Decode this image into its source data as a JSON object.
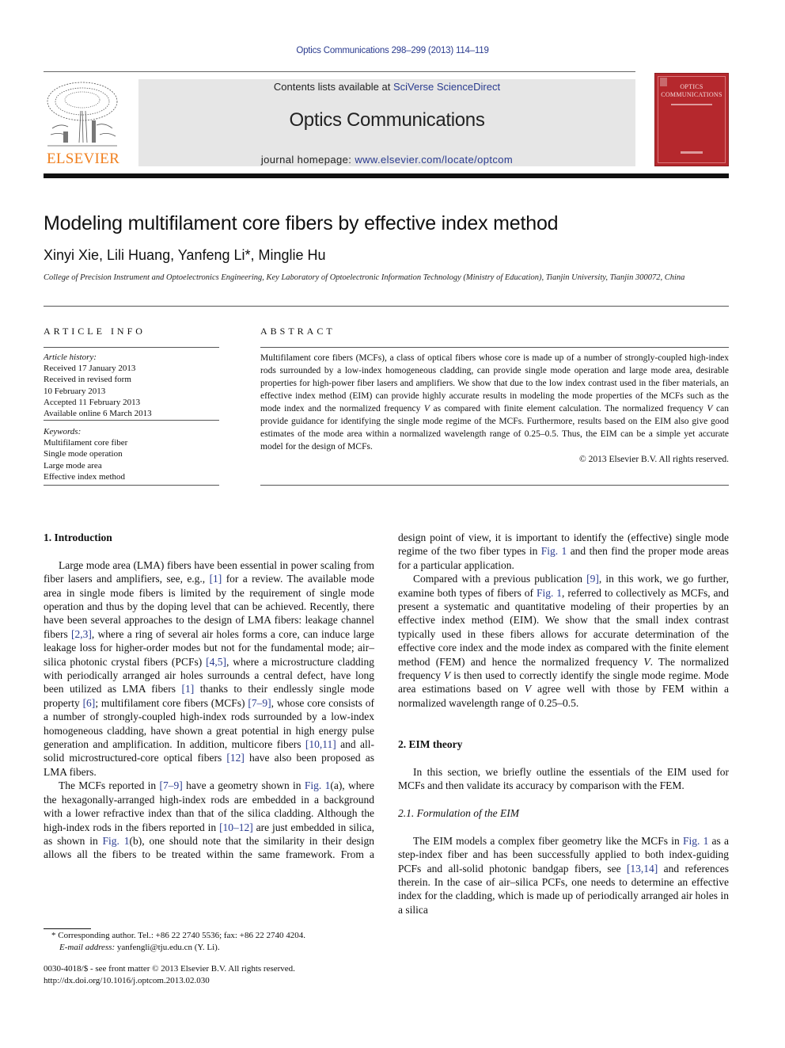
{
  "header": {
    "citation": "Optics Communications 298–299 (2013) 114–119",
    "contents_prefix": "Contents lists available at ",
    "contents_link": "SciVerse ScienceDirect",
    "journal_title": "Optics Communications",
    "homepage_prefix": "journal homepage: ",
    "homepage_link": "www.elsevier.com/locate/optcom",
    "publisher_logo_text": "ELSEVIER",
    "cover_title_line1": "OPTICS",
    "cover_title_line2": "COMMUNICATIONS",
    "colors": {
      "link": "#2a3b8f",
      "publisher_orange": "#f07f1e",
      "cover_red": "#b5282d",
      "banner_gray": "#e6e6e6"
    }
  },
  "article": {
    "title": "Modeling multifilament core fibers by effective index method",
    "authors": "Xinyi Xie, Lili Huang, Yanfeng Li*, Minglie Hu",
    "affiliation": "College of Precision Instrument and Optoelectronics Engineering, Key Laboratory of Optoelectronic Information Technology (Ministry of Education), Tianjin University, Tianjin 300072, China"
  },
  "article_info": {
    "heading": "ARTICLE INFO",
    "history_label": "Article history:",
    "history": [
      "Received 17 January 2013",
      "Received in revised form",
      "10 February 2013",
      "Accepted 11 February 2013",
      "Available online 6 March 2013"
    ],
    "keywords_label": "Keywords:",
    "keywords": [
      "Multifilament core fiber",
      "Single mode operation",
      "Large mode area",
      "Effective index method"
    ]
  },
  "abstract": {
    "heading": "ABSTRACT",
    "text": "Multifilament core fibers (MCFs), a class of optical fibers whose core is made up of a number of strongly-coupled high-index rods surrounded by a low-index homogeneous cladding, can provide single mode operation and large mode area, desirable properties for high-power fiber lasers and amplifiers. We show that due to the low index contrast used in the fiber materials, an effective index method (EIM) can provide highly accurate results in modeling the mode properties of the MCFs such as the mode index and the normalized frequency V as compared with finite element calculation. The normalized frequency V can provide guidance for identifying the single mode regime of the MCFs. Furthermore, results based on the EIM also give good estimates of the mode area within a normalized wavelength range of 0.25–0.5. Thus, the EIM can be a simple yet accurate model for the design of MCFs.",
    "copyright": "© 2013 Elsevier B.V. All rights reserved."
  },
  "body": {
    "sec1_heading": "1.  Introduction",
    "sec1_p1": [
      {
        "t": "Large mode area (LMA) fibers have been essential in power scaling from fiber lasers and amplifiers, see, e.g., "
      },
      {
        "t": "[1]",
        "link": true
      },
      {
        "t": " for a review. The available mode area in single mode fibers is limited by the requirement of single mode operation and thus by the doping level that can be achieved. Recently, there have been several approaches to the design of LMA fibers: leakage channel fibers "
      },
      {
        "t": "[2,3]",
        "link": true
      },
      {
        "t": ", where a ring of several air holes forms a core, can induce large leakage loss for higher-order modes but not for the fundamental mode; air–silica photonic crystal fibers (PCFs) "
      },
      {
        "t": "[4,5]",
        "link": true
      },
      {
        "t": ", where a microstructure cladding with periodically arranged air holes surrounds a central defect, have long been utilized as LMA fibers "
      },
      {
        "t": "[1]",
        "link": true
      },
      {
        "t": " thanks to their endlessly single mode property "
      },
      {
        "t": "[6]",
        "link": true
      },
      {
        "t": "; multifilament core fibers (MCFs) "
      },
      {
        "t": "[7–9]",
        "link": true
      },
      {
        "t": ", whose core consists of a number of strongly-coupled high-index rods surrounded by a low-index homogeneous cladding, have shown a great potential in high energy pulse generation and amplification. In addition, multicore fibers "
      },
      {
        "t": "[10,11]",
        "link": true
      },
      {
        "t": " and all-solid microstructured-core optical fibers "
      },
      {
        "t": "[12]",
        "link": true
      },
      {
        "t": " have also been proposed as LMA fibers."
      }
    ],
    "sec1_p2": [
      {
        "t": "The MCFs reported in "
      },
      {
        "t": "[7–9]",
        "link": true
      },
      {
        "t": " have a geometry shown in "
      },
      {
        "t": "Fig. 1",
        "link": true
      },
      {
        "t": "(a), where the hexagonally-arranged high-index rods are embedded in a background with a lower refractive index than that of the silica cladding. Although the high-index rods in the fibers reported in "
      },
      {
        "t": "[10–12]",
        "link": true
      },
      {
        "t": " are just embedded in silica, as shown in "
      },
      {
        "t": "Fig. 1",
        "link": true
      },
      {
        "t": "(b), one should note that the similarity in their design allows all the fibers to be treated within the same framework. From a design point of view, it is important to identify the (effective) single mode regime of the two fiber types in "
      },
      {
        "t": "Fig. 1",
        "link": true
      },
      {
        "t": " and then find the proper mode areas for a particular application."
      }
    ],
    "sec1_p3": [
      {
        "t": "Compared with a previous publication "
      },
      {
        "t": "[9]",
        "link": true
      },
      {
        "t": ", in this work, we go further, examine both types of fibers of "
      },
      {
        "t": "Fig. 1",
        "link": true
      },
      {
        "t": ", referred to collectively as MCFs, and present a systematic and quantitative modeling of their properties by an effective index method (EIM). We show that the small index contrast typically used in these fibers allows for accurate determination of the effective core index and the mode index as compared with the finite element method (FEM) and hence the normalized frequency "
      },
      {
        "t": "V",
        "em": true
      },
      {
        "t": ". The normalized frequency "
      },
      {
        "t": "V",
        "em": true
      },
      {
        "t": " is then used to correctly identify the single mode regime. Mode area estimations based on "
      },
      {
        "t": "V",
        "em": true
      },
      {
        "t": " agree well with those by FEM within a normalized wavelength range of 0.25–0.5."
      }
    ],
    "sec2_heading": "2.  EIM theory",
    "sec2_p1": [
      {
        "t": "In this section, we briefly outline the essentials of the EIM used for MCFs and then validate its accuracy by comparison with the FEM."
      }
    ],
    "sec21_heading": "2.1.  Formulation of the EIM",
    "sec21_p1": [
      {
        "t": "The EIM models a complex fiber geometry like the MCFs in "
      },
      {
        "t": "Fig. 1",
        "link": true
      },
      {
        "t": " as a step-index fiber and has been successfully applied to both index-guiding PCFs and all-solid photonic bandgap fibers, see "
      },
      {
        "t": "[13,14]",
        "link": true
      },
      {
        "t": " and references therein. In the case of air–silica PCFs, one needs to determine an effective index for the cladding, which is made up of periodically arranged air holes in a silica"
      }
    ]
  },
  "footnotes": {
    "corresponding": "* Corresponding author. Tel.: +86 22 2740 5536; fax: +86 22 2740 4204.",
    "email_label": "E-mail address: ",
    "email": "yanfengli@tju.edu.cn (Y. Li).",
    "issn": "0030-4018/$ - see front matter © 2013 Elsevier B.V. All rights reserved.",
    "doi": "http://dx.doi.org/10.1016/j.optcom.2013.02.030"
  }
}
